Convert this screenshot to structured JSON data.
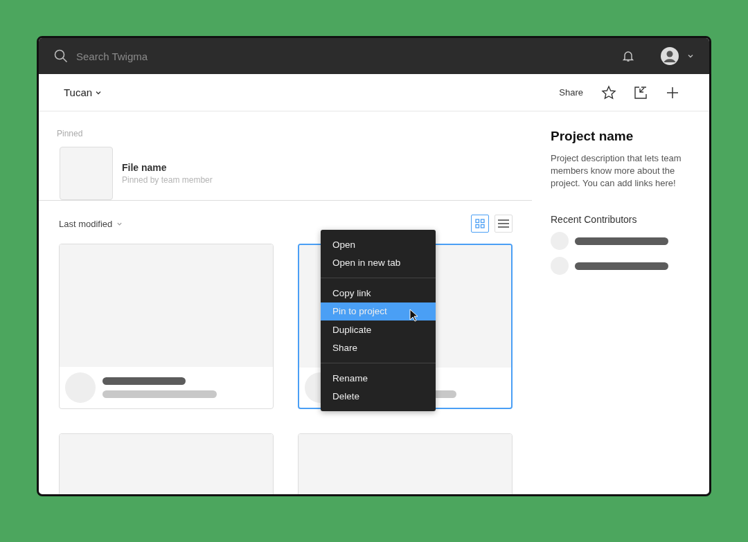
{
  "topbar": {
    "search": {
      "placeholder": "Search Twigma"
    }
  },
  "header": {
    "project": "Tucan",
    "share": "Share"
  },
  "pinned": {
    "label": "Pinned",
    "file": {
      "name": "File name",
      "subtitle": "Pinned by team member"
    }
  },
  "files": {
    "sort": "Last modified",
    "views": [
      {
        "kind": "grid",
        "selected": true
      },
      {
        "kind": "list",
        "selected": false
      }
    ],
    "cards": [
      {
        "selected": false
      },
      {
        "selected": true
      },
      {
        "selected": false
      },
      {
        "selected": false
      }
    ]
  },
  "context_menu": {
    "groups": [
      [
        {
          "label": "Open",
          "selected": false
        },
        {
          "label": "Open in new tab",
          "selected": false
        }
      ],
      [
        {
          "label": "Copy link",
          "selected": false
        },
        {
          "label": "Pin to project",
          "selected": true
        },
        {
          "label": "Duplicate",
          "selected": false
        },
        {
          "label": "Share",
          "selected": false
        }
      ],
      [
        {
          "label": "Rename",
          "selected": false
        },
        {
          "label": "Delete",
          "selected": false
        }
      ]
    ]
  },
  "project_panel": {
    "title": "Project name",
    "description": "Project description that lets team members know more about the project. You can add links here!",
    "contributors_heading": "Recent Contributors",
    "contributors": [
      {
        "kind": "skeleton"
      },
      {
        "kind": "skeleton"
      }
    ]
  }
}
